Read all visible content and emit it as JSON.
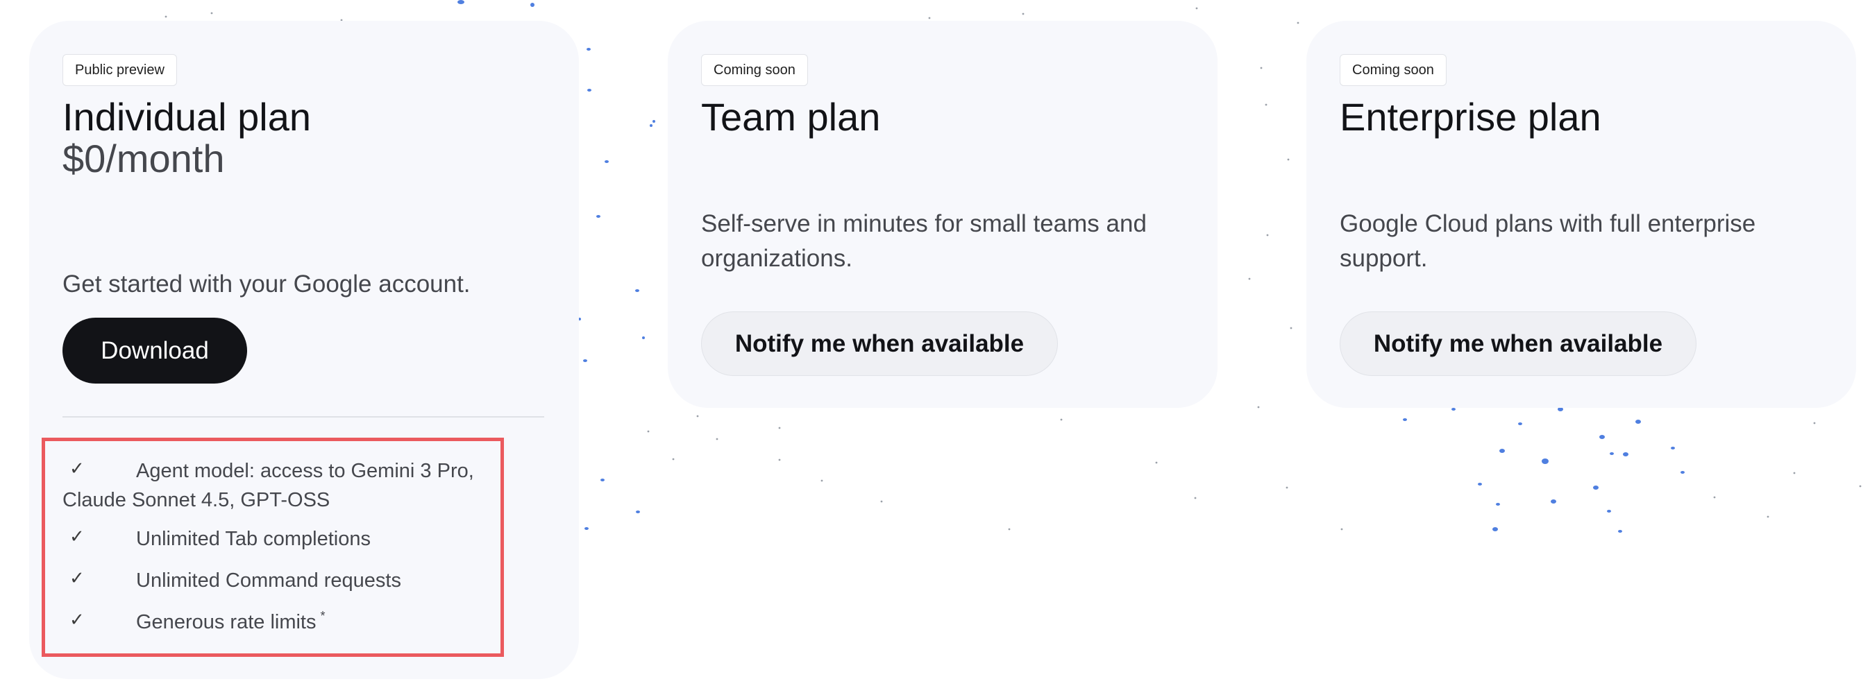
{
  "plans": [
    {
      "badge": "Public preview",
      "title": "Individual plan",
      "price": "$0/month",
      "description": "Get started with your Google account.",
      "cta_label": "Download",
      "features": [
        {
          "icon": "check-icon",
          "line1": "Agent model: access to Gemini 3 Pro,",
          "line2": "Claude Sonnet 4.5, GPT-OSS"
        },
        {
          "icon": "check-icon",
          "line1": "Unlimited Tab completions"
        },
        {
          "icon": "check-icon",
          "line1": "Unlimited Command requests"
        },
        {
          "icon": "check-icon",
          "line1": "Generous rate limits",
          "footnote_mark": "*"
        }
      ]
    },
    {
      "badge": "Coming soon",
      "title": "Team plan",
      "description": "Self-serve in minutes for small teams and organizations.",
      "cta_label": "Notify me when available"
    },
    {
      "badge": "Coming soon",
      "title": "Enterprise plan",
      "description": "Google Cloud plans with full enterprise support.",
      "cta_label": "Notify me when available"
    }
  ],
  "colors": {
    "card_background": "#f7f8fc",
    "primary_button": "#121317",
    "secondary_button": "#eff0f4",
    "highlight_border": "#eb5a5e",
    "decorative_dots": "#4f7fe0"
  }
}
